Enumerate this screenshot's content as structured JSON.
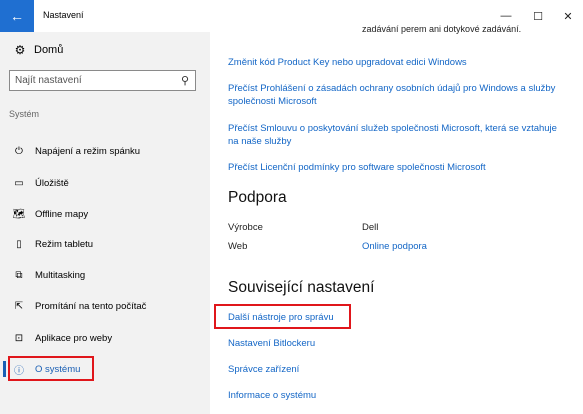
{
  "window": {
    "title": "Nastavení",
    "controls": {
      "minimize": "—",
      "maximize": "☐",
      "close": "✕"
    }
  },
  "sidebar": {
    "home_label": "Domů",
    "search_placeholder": "Najít nastavení",
    "section_label": "Systém",
    "items": [
      {
        "label": "Napájení a režim spánku",
        "icon": "power-icon",
        "glyph": "⏻"
      },
      {
        "label": "Úložiště",
        "icon": "storage-icon",
        "glyph": "▭"
      },
      {
        "label": "Offline mapy",
        "icon": "map-icon",
        "glyph": "🗺"
      },
      {
        "label": "Režim tabletu",
        "icon": "tablet-icon",
        "glyph": "▯"
      },
      {
        "label": "Multitasking",
        "icon": "multitasking-icon",
        "glyph": "⧉"
      },
      {
        "label": "Promítání na tento počítač",
        "icon": "projecting-icon",
        "glyph": "⇱"
      },
      {
        "label": "Aplikace pro weby",
        "icon": "web-apps-icon",
        "glyph": "⊡"
      },
      {
        "label": "O systému",
        "icon": "info-icon",
        "glyph": "ⓘ",
        "active": true
      }
    ]
  },
  "main": {
    "truncated_text": "zadávání perem ani dotykové zadávání.",
    "links_top": [
      "Změnit kód Product Key nebo upgradovat edici Windows",
      "Přečíst Prohlášení o zásadách ochrany osobních údajů pro Windows a služby společnosti Microsoft",
      "Přečíst Smlouvu o poskytování služeb společnosti Microsoft, která se vztahuje na naše služby",
      "Přečíst Licenční podmínky pro software společnosti Microsoft"
    ],
    "support": {
      "heading": "Podpora",
      "manufacturer_label": "Výrobce",
      "manufacturer_value": "Dell",
      "web_label": "Web",
      "web_value": "Online podpora"
    },
    "related": {
      "heading": "Související nastavení",
      "links": [
        "Další nástroje pro správu",
        "Nastavení Bitlockeru",
        "Správce zařízení",
        "Informace o systému"
      ]
    }
  },
  "colors": {
    "accent": "#1a5fb4",
    "link": "#1366c6",
    "highlight_box": "#e0161b",
    "sidebar_bg": "#f2f2f2"
  }
}
